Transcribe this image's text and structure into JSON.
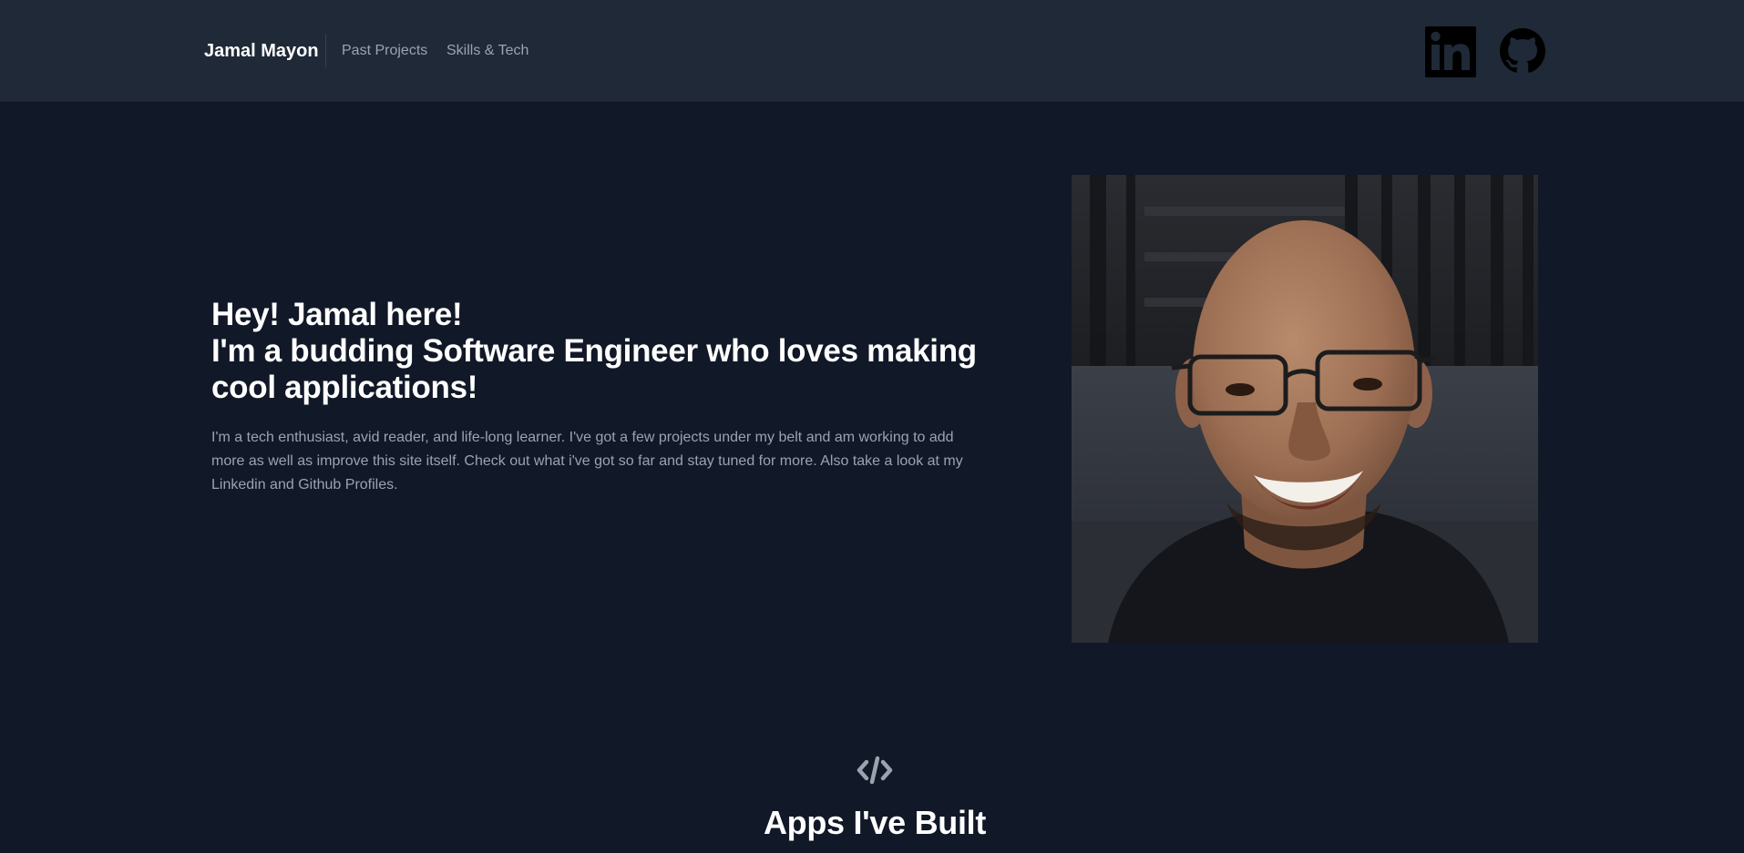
{
  "nav": {
    "brand": "Jamal Mayon",
    "links": [
      {
        "label": "Past Projects"
      },
      {
        "label": "Skills & Tech"
      }
    ],
    "social": {
      "linkedin_icon": "linkedin-icon",
      "github_icon": "github-icon"
    }
  },
  "hero": {
    "headline_lines": [
      "Hey! Jamal here!",
      "I'm a budding Software Engineer who loves making",
      "cool applications!"
    ],
    "description": "I'm a tech enthusiast, avid reader, and life-long learner. I've got a few projects under my belt and am working to add more as well as improve this site itself. Check out what i've got so far and stay tuned for more. Also take a look at my Linkedin and Github Profiles.",
    "photo_icon": "profile-photo"
  },
  "apps_section": {
    "icon": "code-icon",
    "title": "Apps I've Built"
  },
  "colors": {
    "background": "#111827",
    "navbar": "#1f2937",
    "heading": "#ffffff",
    "muted_text": "#9ca3af"
  }
}
